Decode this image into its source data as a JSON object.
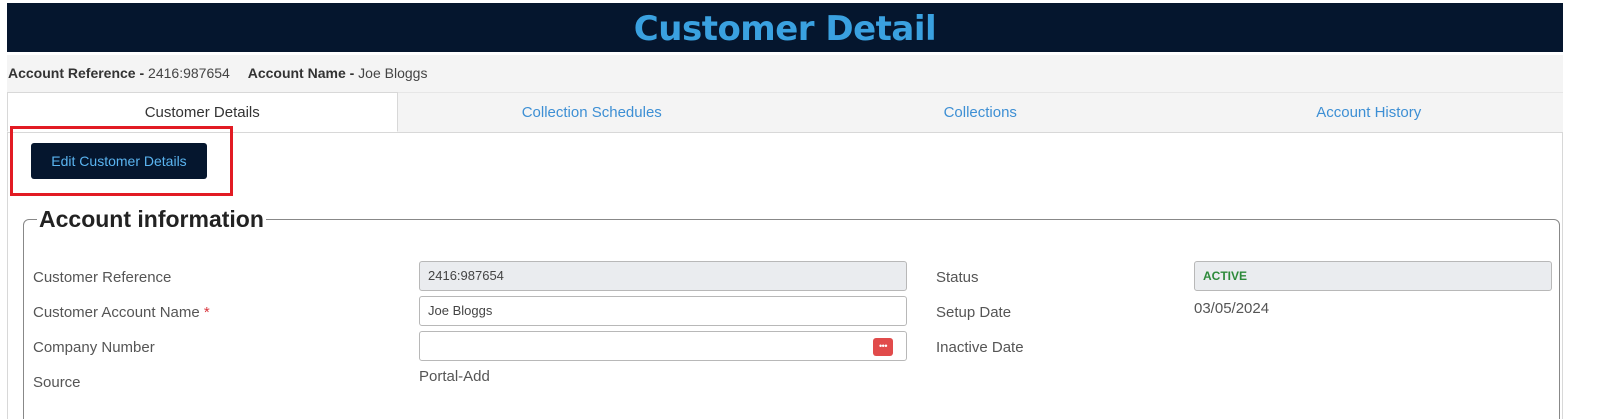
{
  "header": {
    "title": "Customer Detail"
  },
  "account": {
    "ref_label": "Account Reference -",
    "ref_value": "2416:987654",
    "name_label": "Account Name -",
    "name_value": "Joe Bloggs"
  },
  "tabs": [
    {
      "label": "Customer Details",
      "active": true
    },
    {
      "label": "Collection Schedules",
      "active": false
    },
    {
      "label": "Collections",
      "active": false
    },
    {
      "label": "Account History",
      "active": false
    }
  ],
  "actions": {
    "edit_label": "Edit Customer Details"
  },
  "section": {
    "title": "Account information",
    "fields": {
      "customer_reference": {
        "label": "Customer Reference",
        "value": "2416:987654"
      },
      "customer_account_name": {
        "label": "Customer Account Name",
        "required_mark": "*",
        "value": "Joe Bloggs"
      },
      "company_number": {
        "label": "Company Number",
        "value": ""
      },
      "source": {
        "label": "Source",
        "value": "Portal-Add"
      },
      "status": {
        "label": "Status",
        "value": "ACTIVE"
      },
      "setup_date": {
        "label": "Setup Date",
        "value": "03/05/2024"
      },
      "inactive_date": {
        "label": "Inactive Date",
        "value": ""
      }
    }
  },
  "colors": {
    "header_bg": "#05162e",
    "title": "#3aa1e0",
    "tab_link": "#3d8fd4",
    "highlight": "#e21b23",
    "status_active": "#2d8a3a",
    "dots_button": "#e14b4b"
  },
  "icons": {
    "company_lookup": "more-dots-icon"
  }
}
